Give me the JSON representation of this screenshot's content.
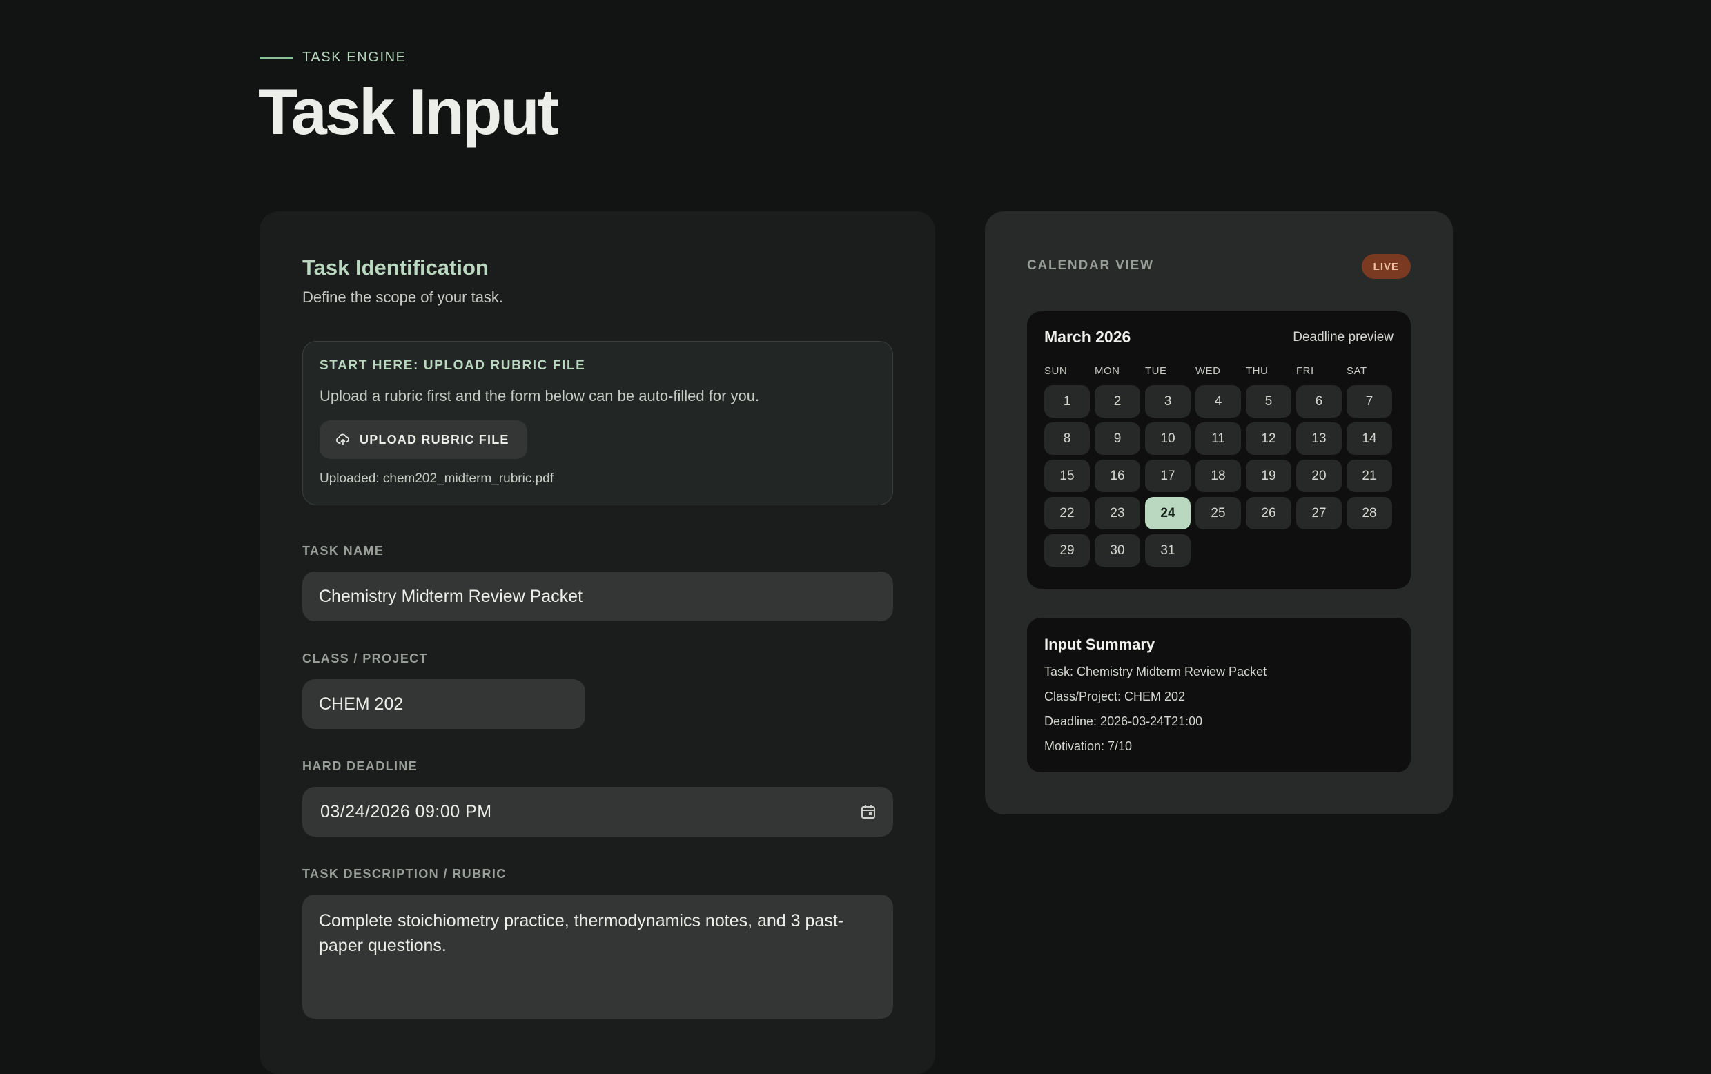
{
  "header": {
    "eyebrow": "TASK ENGINE",
    "title": "Task Input"
  },
  "form": {
    "section_title": "Task Identification",
    "section_subtitle": "Define the scope of your task.",
    "upload": {
      "heading": "START HERE: UPLOAD RUBRIC FILE",
      "description": "Upload a rubric first and the form below can be auto-filled for you.",
      "button_label": "UPLOAD RUBRIC FILE",
      "status": "Uploaded: chem202_midterm_rubric.pdf",
      "icon": "cloud-upload-icon"
    },
    "task_name": {
      "label": "TASK NAME",
      "value": "Chemistry Midterm Review Packet"
    },
    "class_project": {
      "label": "CLASS / PROJECT",
      "value": "CHEM 202"
    },
    "hard_deadline": {
      "label": "HARD DEADLINE",
      "value": "03/24/2026 09:00 PM",
      "icon": "calendar-icon"
    },
    "description": {
      "label": "TASK DESCRIPTION / RUBRIC",
      "value": "Complete stoichiometry practice, thermodynamics notes, and 3 past-paper questions."
    }
  },
  "calendar_panel": {
    "heading": "CALENDAR VIEW",
    "badge": "LIVE",
    "calendar": {
      "month": "March 2026",
      "preview_label": "Deadline preview",
      "weekdays": [
        "SUN",
        "MON",
        "TUE",
        "WED",
        "THU",
        "FRI",
        "SAT"
      ],
      "days": [
        "1",
        "2",
        "3",
        "4",
        "5",
        "6",
        "7",
        "8",
        "9",
        "10",
        "11",
        "12",
        "13",
        "14",
        "15",
        "16",
        "17",
        "18",
        "19",
        "20",
        "21",
        "22",
        "23",
        "24",
        "25",
        "26",
        "27",
        "28",
        "29",
        "30",
        "31"
      ],
      "selected_day": "24"
    },
    "summary": {
      "title": "Input Summary",
      "task": "Task: Chemistry Midterm Review Packet",
      "class_project": "Class/Project: CHEM 202",
      "deadline": "Deadline: 2026-03-24T21:00",
      "motivation": "Motivation: 7/10"
    }
  },
  "colors": {
    "accent": "#b9d8bf",
    "background": "#121413",
    "panel": "#1b1d1c",
    "badge": "#7a3a22"
  }
}
